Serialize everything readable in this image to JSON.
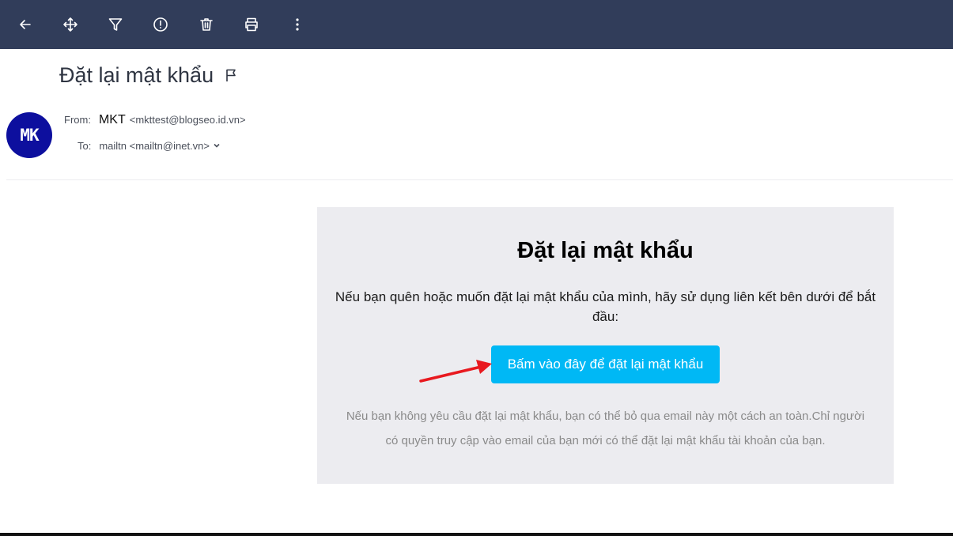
{
  "toolbar": {
    "buttons": [
      {
        "icon": "back-arrow-icon"
      },
      {
        "icon": "move-icon"
      },
      {
        "icon": "filter-icon"
      },
      {
        "icon": "spam-icon"
      },
      {
        "icon": "trash-icon"
      },
      {
        "icon": "print-icon"
      },
      {
        "icon": "more-vertical-icon"
      }
    ],
    "background": "#313d5a"
  },
  "email": {
    "subject": "Đặt lại mật khẩu",
    "avatar_initials": "MK",
    "avatar_color": "#0d0f9e",
    "from_label": "From:",
    "from_name": "MKT",
    "from_email": "<mkttest@blogseo.id.vn>",
    "to_label": "To:",
    "to_value": "mailtn <mailtn@inet.vn>"
  },
  "body": {
    "title": "Đặt lại mật khẩu",
    "description": "Nếu bạn quên hoặc muốn đặt lại mật khẩu của mình, hãy sử dụng liên kết bên dưới để bắt đầu:",
    "button_label": "Bấm vào đây để đặt lại mật khẩu",
    "button_color": "#00b8f5",
    "note": "Nếu bạn không yêu cầu đặt lại mật khẩu, bạn có thể bỏ qua email này một cách an toàn.Chỉ người có quyền truy cập vào email của bạn mới có thể đặt lại mật khẩu tài khoản của bạn."
  },
  "annotation": {
    "arrow_color": "#e8191f"
  }
}
